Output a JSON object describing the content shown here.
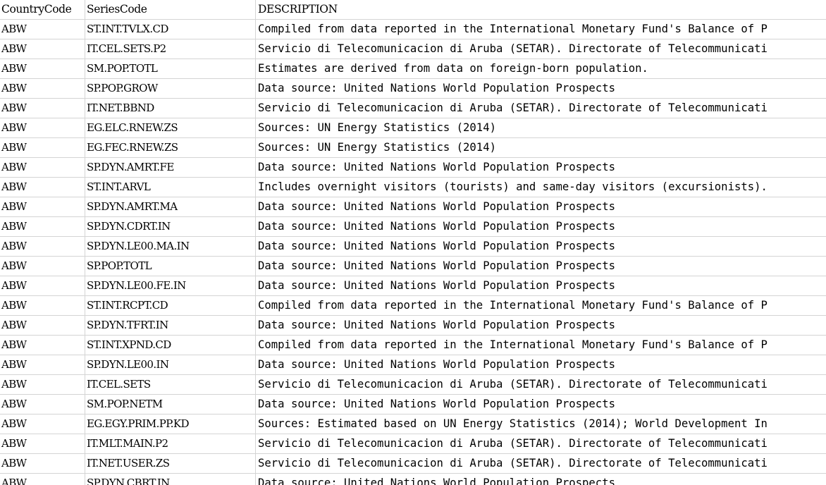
{
  "headers": [
    "CountryCode",
    "SeriesCode",
    "DESCRIPTION"
  ],
  "rows": [
    [
      "ABW",
      "ST.INT.TVLX.CD",
      "Compiled from data reported in the International Monetary Fund's Balance of P"
    ],
    [
      "ABW",
      "IT.CEL.SETS.P2",
      "Servicio di Telecomunicacion di Aruba (SETAR). Directorate of Telecommunicati"
    ],
    [
      "ABW",
      "SM.POP.TOTL",
      "Estimates are derived from data on foreign-born population."
    ],
    [
      "ABW",
      "SP.POP.GROW",
      "Data source: United Nations World Population Prospects"
    ],
    [
      "ABW",
      "IT.NET.BBND",
      "Servicio di Telecomunicacion di Aruba (SETAR). Directorate of Telecommunicati"
    ],
    [
      "ABW",
      "EG.ELC.RNEW.ZS",
      "Sources: UN Energy Statistics (2014)"
    ],
    [
      "ABW",
      "EG.FEC.RNEW.ZS",
      "Sources: UN Energy Statistics (2014)"
    ],
    [
      "ABW",
      "SP.DYN.AMRT.FE",
      "Data source: United Nations World Population Prospects"
    ],
    [
      "ABW",
      "ST.INT.ARVL",
      "Includes overnight visitors (tourists) and same-day visitors (excursionists)."
    ],
    [
      "ABW",
      "SP.DYN.AMRT.MA",
      "Data source: United Nations World Population Prospects"
    ],
    [
      "ABW",
      "SP.DYN.CDRT.IN",
      "Data source: United Nations World Population Prospects"
    ],
    [
      "ABW",
      "SP.DYN.LE00.MA.IN",
      "Data source: United Nations World Population Prospects"
    ],
    [
      "ABW",
      "SP.POP.TOTL",
      "Data source: United Nations World Population Prospects"
    ],
    [
      "ABW",
      "SP.DYN.LE00.FE.IN",
      "Data source: United Nations World Population Prospects"
    ],
    [
      "ABW",
      "ST.INT.RCPT.CD",
      "Compiled from data reported in the International Monetary Fund's Balance of P"
    ],
    [
      "ABW",
      "SP.DYN.TFRT.IN",
      "Data source: United Nations World Population Prospects"
    ],
    [
      "ABW",
      "ST.INT.XPND.CD",
      "Compiled from data reported in the International Monetary Fund's Balance of P"
    ],
    [
      "ABW",
      "SP.DYN.LE00.IN",
      "Data source: United Nations World Population Prospects"
    ],
    [
      "ABW",
      "IT.CEL.SETS",
      "Servicio di Telecomunicacion di Aruba (SETAR). Directorate of Telecommunicati"
    ],
    [
      "ABW",
      "SM.POP.NETM",
      "Data source: United Nations World Population Prospects"
    ],
    [
      "ABW",
      "EG.EGY.PRIM.PP.KD",
      "Sources: Estimated based on UN Energy Statistics (2014); World Development In"
    ],
    [
      "ABW",
      "IT.MLT.MAIN.P2",
      "Servicio di Telecomunicacion di Aruba (SETAR). Directorate of Telecommunicati"
    ],
    [
      "ABW",
      "IT.NET.USER.ZS",
      "Servicio di Telecomunicacion di Aruba (SETAR). Directorate of Telecommunicati"
    ],
    [
      "ABW",
      "SP.DYN.CBRT.IN",
      "Data source: United Nations World Population Prospects"
    ]
  ]
}
